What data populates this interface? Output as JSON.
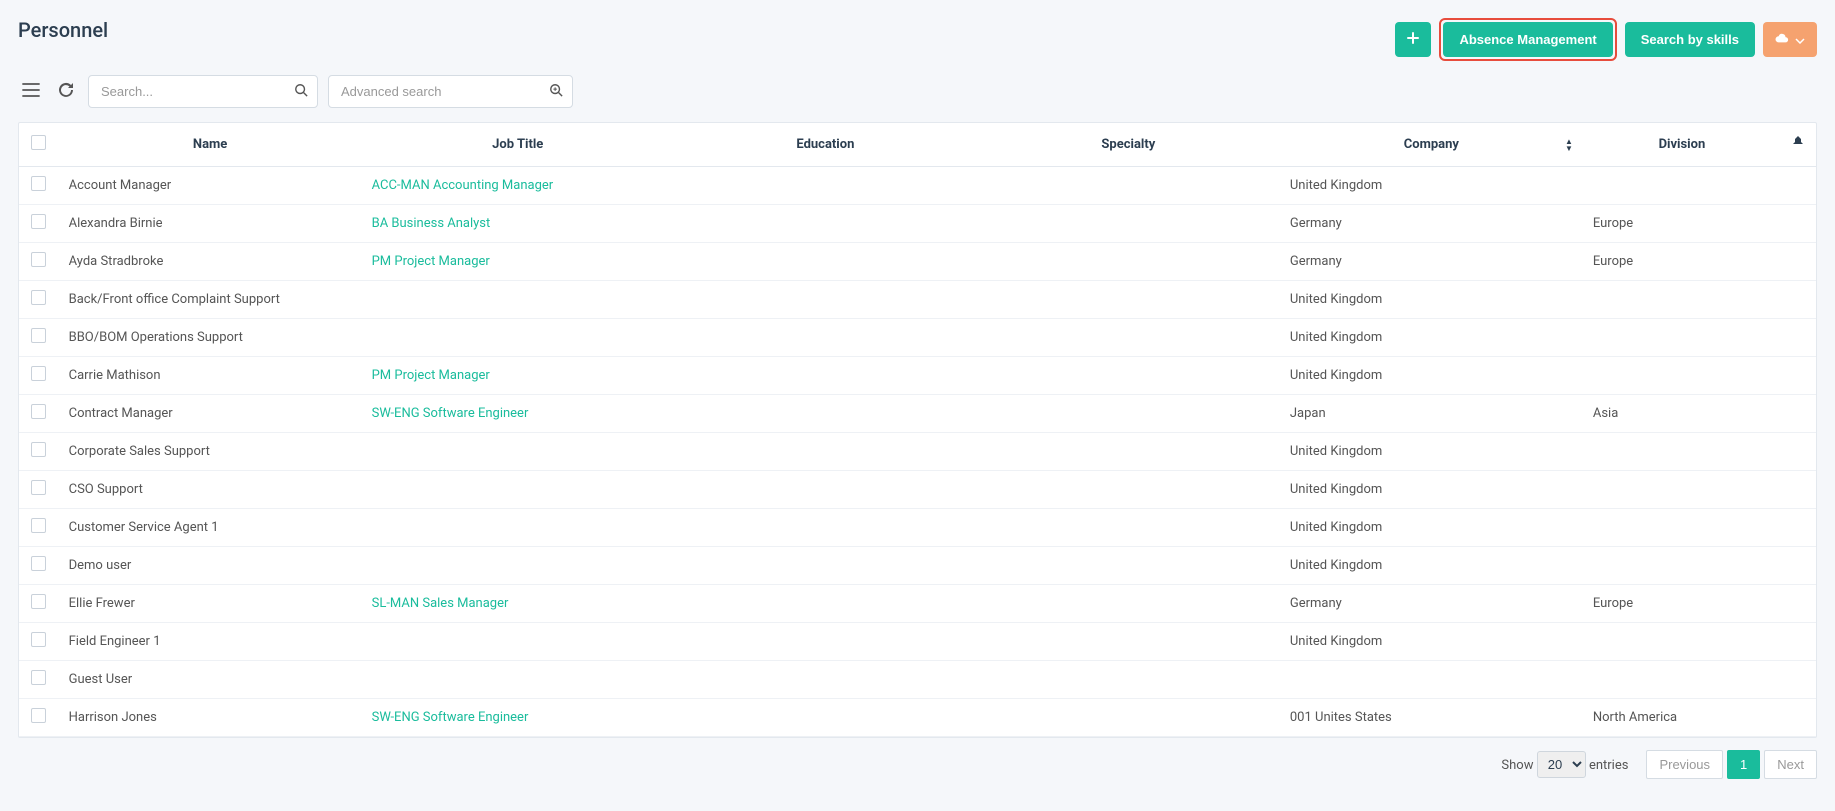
{
  "header": {
    "title": "Personnel",
    "add_label": "+",
    "absence_label": "Absence Management",
    "search_skills_label": "Search by skills"
  },
  "toolbar": {
    "search_placeholder": "Search...",
    "advanced_placeholder": "Advanced search"
  },
  "table": {
    "columns": {
      "name": "Name",
      "job": "Job Title",
      "education": "Education",
      "specialty": "Specialty",
      "company": "Company",
      "division": "Division"
    },
    "rows": [
      {
        "name": "Account Manager",
        "job": "ACC-MAN Accounting Manager",
        "education": "",
        "specialty": "",
        "company": "United Kingdom",
        "division": ""
      },
      {
        "name": "Alexandra Birnie",
        "job": "BA Business Analyst",
        "education": "",
        "specialty": "",
        "company": "Germany",
        "division": "Europe"
      },
      {
        "name": "Ayda Stradbroke",
        "job": "PM Project Manager",
        "education": "",
        "specialty": "",
        "company": "Germany",
        "division": "Europe"
      },
      {
        "name": "Back/Front office Complaint Support",
        "job": "",
        "education": "",
        "specialty": "",
        "company": "United Kingdom",
        "division": ""
      },
      {
        "name": "BBO/BOM Operations Support",
        "job": "",
        "education": "",
        "specialty": "",
        "company": "United Kingdom",
        "division": ""
      },
      {
        "name": "Carrie Mathison",
        "job": "PM Project Manager",
        "education": "",
        "specialty": "",
        "company": "United Kingdom",
        "division": ""
      },
      {
        "name": "Contract Manager",
        "job": "SW-ENG Software Engineer",
        "education": "",
        "specialty": "",
        "company": "Japan",
        "division": "Asia"
      },
      {
        "name": "Corporate Sales Support",
        "job": "",
        "education": "",
        "specialty": "",
        "company": "United Kingdom",
        "division": ""
      },
      {
        "name": "CSO Support",
        "job": "",
        "education": "",
        "specialty": "",
        "company": "United Kingdom",
        "division": ""
      },
      {
        "name": "Customer Service Agent 1",
        "job": "",
        "education": "",
        "specialty": "",
        "company": "United Kingdom",
        "division": ""
      },
      {
        "name": "Demo user",
        "job": "",
        "education": "",
        "specialty": "",
        "company": "United Kingdom",
        "division": ""
      },
      {
        "name": "Ellie Frewer",
        "job": "SL-MAN Sales Manager",
        "education": "",
        "specialty": "",
        "company": "Germany",
        "division": "Europe"
      },
      {
        "name": "Field Engineer 1",
        "job": "",
        "education": "",
        "specialty": "",
        "company": "United Kingdom",
        "division": ""
      },
      {
        "name": "Guest User",
        "job": "",
        "education": "",
        "specialty": "",
        "company": "",
        "division": ""
      },
      {
        "name": "Harrison Jones",
        "job": "SW-ENG Software Engineer",
        "education": "",
        "specialty": "",
        "company": "001 Unites States",
        "division": "North America"
      }
    ]
  },
  "footer": {
    "show_label": "Show",
    "entries_label": "entries",
    "page_size": "20",
    "previous_label": "Previous",
    "current_page": "1",
    "next_label": "Next"
  }
}
